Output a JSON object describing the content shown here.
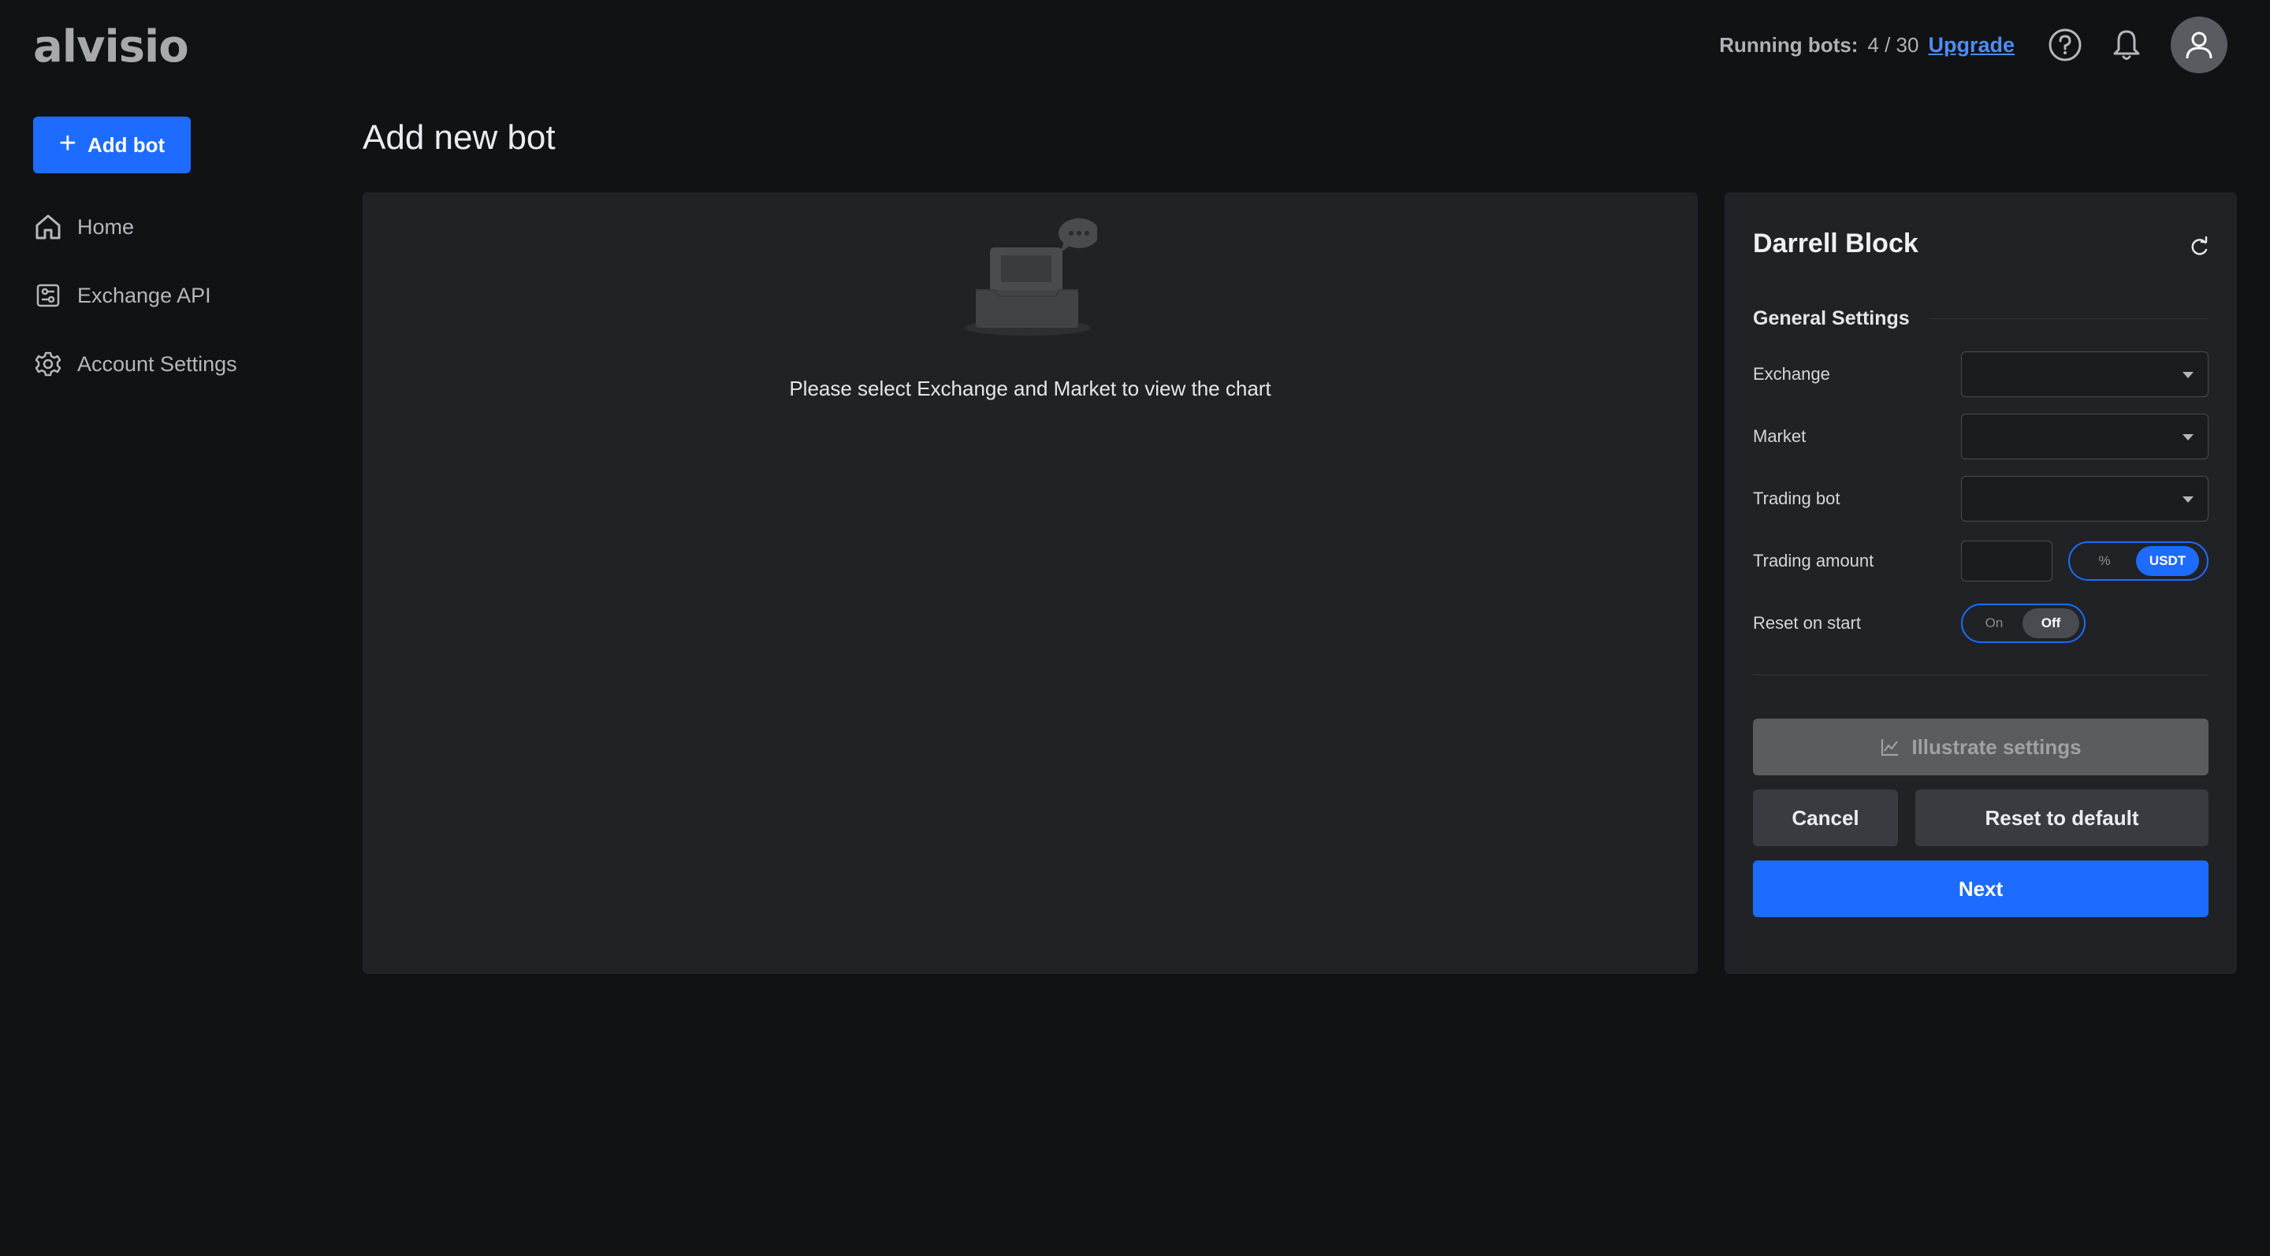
{
  "app": {
    "logo_text": "alvisio"
  },
  "topbar": {
    "running_label": "Running bots:",
    "running_count": "4 / 30",
    "upgrade_label": "Upgrade",
    "help_icon": "help-circle-icon",
    "notifications_icon": "bell-icon",
    "avatar_icon": "user-icon"
  },
  "sidebar": {
    "add_bot_label": "Add bot",
    "items": [
      {
        "label": "Home",
        "icon": "home-icon"
      },
      {
        "label": "Exchange API",
        "icon": "sliders-icon"
      },
      {
        "label": "Account Settings",
        "icon": "gear-icon"
      }
    ]
  },
  "main": {
    "title": "Add new bot",
    "chart_empty_text": "Please select Exchange and Market to view the chart"
  },
  "settings": {
    "name": "Darrell Block",
    "section_title": "General Settings",
    "fields": {
      "exchange_label": "Exchange",
      "exchange_value": "",
      "market_label": "Market",
      "market_value": "",
      "trading_bot_label": "Trading bot",
      "trading_bot_value": "",
      "trading_amount_label": "Trading amount",
      "trading_amount_value": "",
      "unit_options": [
        "%",
        "USDT"
      ],
      "unit_selected": "USDT",
      "reset_on_start_label": "Reset on start",
      "reset_options": [
        "On",
        "Off"
      ],
      "reset_selected": "Off"
    },
    "buttons": {
      "illustrate": "Illustrate settings",
      "cancel": "Cancel",
      "reset_default": "Reset to default",
      "next": "Next"
    }
  },
  "colors": {
    "background": "#111214",
    "panel": "#212226",
    "accent": "#1e6bff",
    "link": "#4c8dff"
  }
}
